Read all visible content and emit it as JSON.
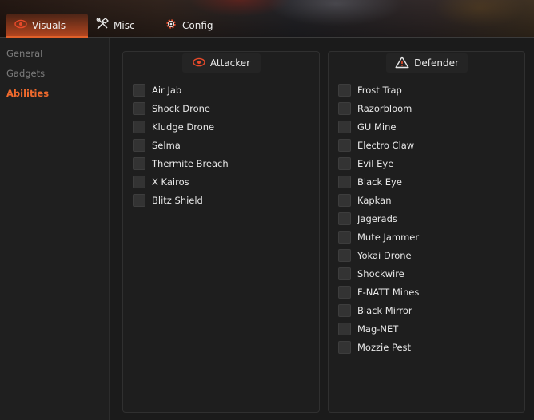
{
  "tabs": {
    "visuals": "Visuals",
    "misc": "Misc",
    "config": "Config"
  },
  "sidebar": {
    "items": [
      "General",
      "Gadgets",
      "Abilities"
    ],
    "active": "Abilities"
  },
  "attacker": {
    "title": "Attacker",
    "items": [
      "Air Jab",
      "Shock Drone",
      "Kludge Drone",
      "Selma",
      "Thermite Breach",
      "X Kairos",
      "Blitz Shield"
    ]
  },
  "defender": {
    "title": "Defender",
    "items": [
      "Frost Trap",
      "Razorbloom",
      "GU Mine",
      "Electro Claw",
      "Evil Eye",
      "Black Eye",
      "Kapkan",
      "Jagerads",
      "Mute Jammer",
      "Yokai Drone",
      "Shockwire",
      "F-NATT Mines",
      "Black Mirror",
      "Mag-NET",
      "Mozzie Pest"
    ]
  },
  "colors": {
    "accent": "#e0602a",
    "active_text": "#f06a2d",
    "background": "#1b1b1b"
  }
}
